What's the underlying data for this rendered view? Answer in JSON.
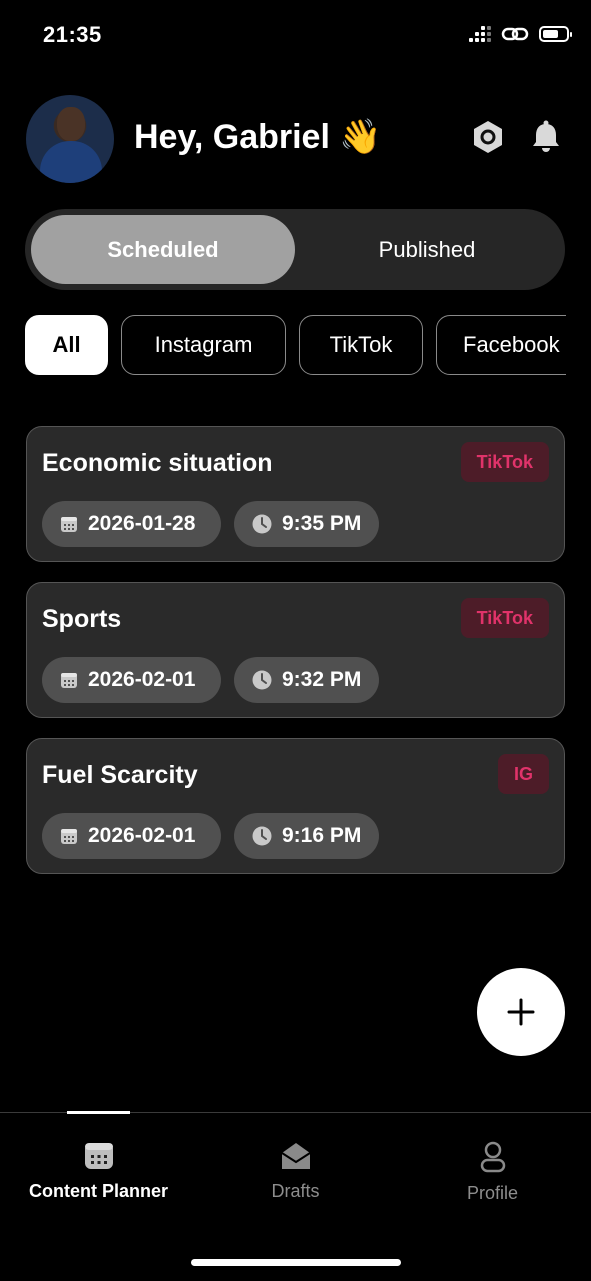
{
  "status_bar": {
    "time": "21:35"
  },
  "header": {
    "greeting": "Hey, Gabriel 👋"
  },
  "segmented": {
    "tabs": [
      "Scheduled",
      "Published"
    ],
    "active": "Scheduled"
  },
  "filters": {
    "chips": [
      "All",
      "Instagram",
      "TikTok",
      "Facebook"
    ],
    "active": "All"
  },
  "posts": [
    {
      "title": "Economic situation",
      "platform": "TikTok",
      "date": "2026-01-28",
      "time": "9:35 PM"
    },
    {
      "title": "Sports",
      "platform": "TikTok",
      "date": "2026-02-01",
      "time": "9:32 PM"
    },
    {
      "title": "Fuel Scarcity",
      "platform": "IG",
      "date": "2026-02-01",
      "time": "9:16 PM"
    }
  ],
  "tabbar": {
    "items": [
      {
        "label": "Content Planner",
        "icon": "calendar-icon"
      },
      {
        "label": "Drafts",
        "icon": "envelope-open-icon"
      },
      {
        "label": "Profile",
        "icon": "user-icon"
      }
    ],
    "active": "Content Planner"
  },
  "colors": {
    "background": "#000000",
    "card": "#2a2a2a",
    "badge_text": "#e0336a",
    "badge_bg": "#4d1c28"
  }
}
